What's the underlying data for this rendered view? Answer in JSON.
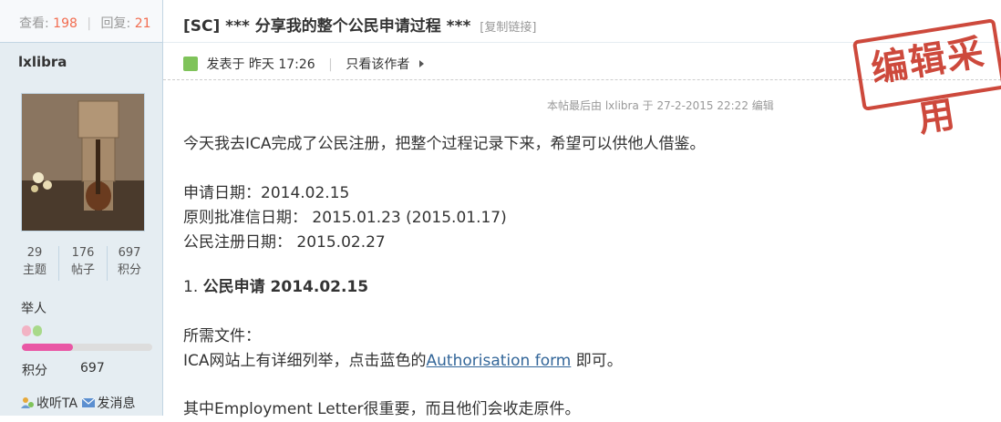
{
  "thread": {
    "views_label": "查看:",
    "views": "198",
    "replies_label": "回复:",
    "replies": "21",
    "title": "[SC] *** 分享我的整个公民申请过程 ***",
    "copy_link": "[复制链接]"
  },
  "user": {
    "name": "lxlibra",
    "stats": [
      {
        "value": "29",
        "label": "主题"
      },
      {
        "value": "176",
        "label": "帖子"
      },
      {
        "value": "697",
        "label": "积分"
      }
    ],
    "rank": "举人",
    "rank_progress": 0.39,
    "points_label": "积分",
    "points": "697",
    "follow_label": "收听TA",
    "message_label": "发消息"
  },
  "post": {
    "posted_label": "发表于 昨天 17:26",
    "author_only_label": "只看该作者",
    "edited_note": "本帖最后由 lxlibra 于 27-2-2015 22:22 编辑",
    "stamp_text": "编辑采用",
    "lines": [
      "今天我去ICA完成了公民注册，把整个过程记录下来，希望可以供他人借鉴。",
      "申请日期：2014.02.15",
      "原则批准信日期： 2015.01.23 (2015.01.17)",
      "公民注册日期： 2015.02.27",
      "1. ",
      "公民申请 2014.02.15",
      "所需文件：",
      "ICA网站上有详细列举，点击蓝色的",
      "Authorisation form",
      " 即可。",
      "其中Employment Letter很重要，而且他们会收走原件。"
    ]
  },
  "colors": {
    "accent_red": "#f26c4f",
    "link": "#336699",
    "progress": "#e957a5",
    "stamp": "#c93a2c"
  }
}
